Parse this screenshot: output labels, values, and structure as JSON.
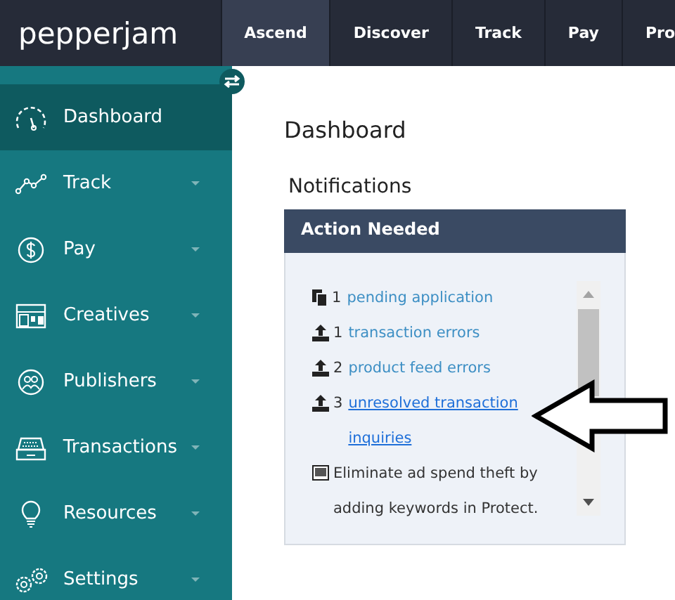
{
  "logo": "pepperjam",
  "top_tabs": [
    {
      "label": "Ascend",
      "selected": true
    },
    {
      "label": "Discover",
      "selected": false
    },
    {
      "label": "Track",
      "selected": false
    },
    {
      "label": "Pay",
      "selected": false
    },
    {
      "label": "Pro",
      "selected": false
    }
  ],
  "sidebar": {
    "items": [
      {
        "label": "Dashboard",
        "selected": true
      },
      {
        "label": "Track",
        "selected": false
      },
      {
        "label": "Pay",
        "selected": false
      },
      {
        "label": "Creatives",
        "selected": false
      },
      {
        "label": "Publishers",
        "selected": false
      },
      {
        "label": "Transactions",
        "selected": false
      },
      {
        "label": "Resources",
        "selected": false
      },
      {
        "label": "Settings",
        "selected": false
      }
    ]
  },
  "page_title": "Dashboard",
  "notifications": {
    "title": "Notifications",
    "panel_title": "Action Needed",
    "items": [
      {
        "kind": "document",
        "count": "1",
        "link": "pending application",
        "hovered": false
      },
      {
        "kind": "upload",
        "count": "1",
        "link": "transaction errors",
        "hovered": false
      },
      {
        "kind": "upload",
        "count": "2",
        "link": "product feed errors",
        "hovered": false
      },
      {
        "kind": "upload",
        "count": "3",
        "link": "unresolved transaction inquiries",
        "hovered": true
      },
      {
        "kind": "tip",
        "text": "Eliminate ad spend theft by adding keywords in Protect."
      }
    ]
  }
}
